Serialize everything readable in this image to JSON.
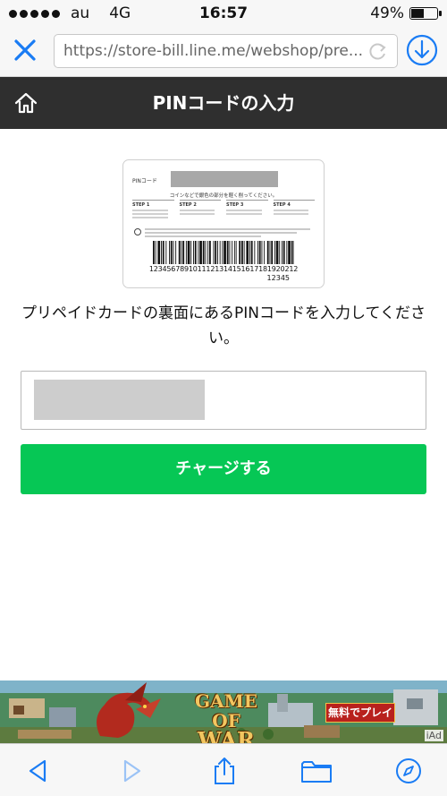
{
  "status_bar": {
    "carrier": "au",
    "network": "4G",
    "time": "16:57",
    "battery_percent_label": "49%",
    "battery_level": 0.49
  },
  "browser": {
    "url": "https://store-bill.line.me/webshop/pre..."
  },
  "header": {
    "title": "PINコードの入力"
  },
  "card_illustration": {
    "pin_label": "PINコード",
    "scratch_text": "コインなどで銀色の部分を軽く削ってください。",
    "steps": [
      "STEP 1",
      "STEP 2",
      "STEP 3",
      "STEP 4"
    ],
    "barcode_number": "123456789101112131415161718192021​2",
    "barcode_suffix": "12345"
  },
  "instruction": "プリペイドカードの裏面にあるPINコードを入力してください。",
  "charge_button": {
    "label": "チャージする",
    "color": "#06c755"
  },
  "ad": {
    "logo_line1": "GAME OF",
    "logo_line2": "WAR",
    "cta": "無料でプレイ",
    "badge": "iAd"
  },
  "colors": {
    "accent_blue": "#1a7cf4",
    "header_bg": "#2f2f2f"
  }
}
